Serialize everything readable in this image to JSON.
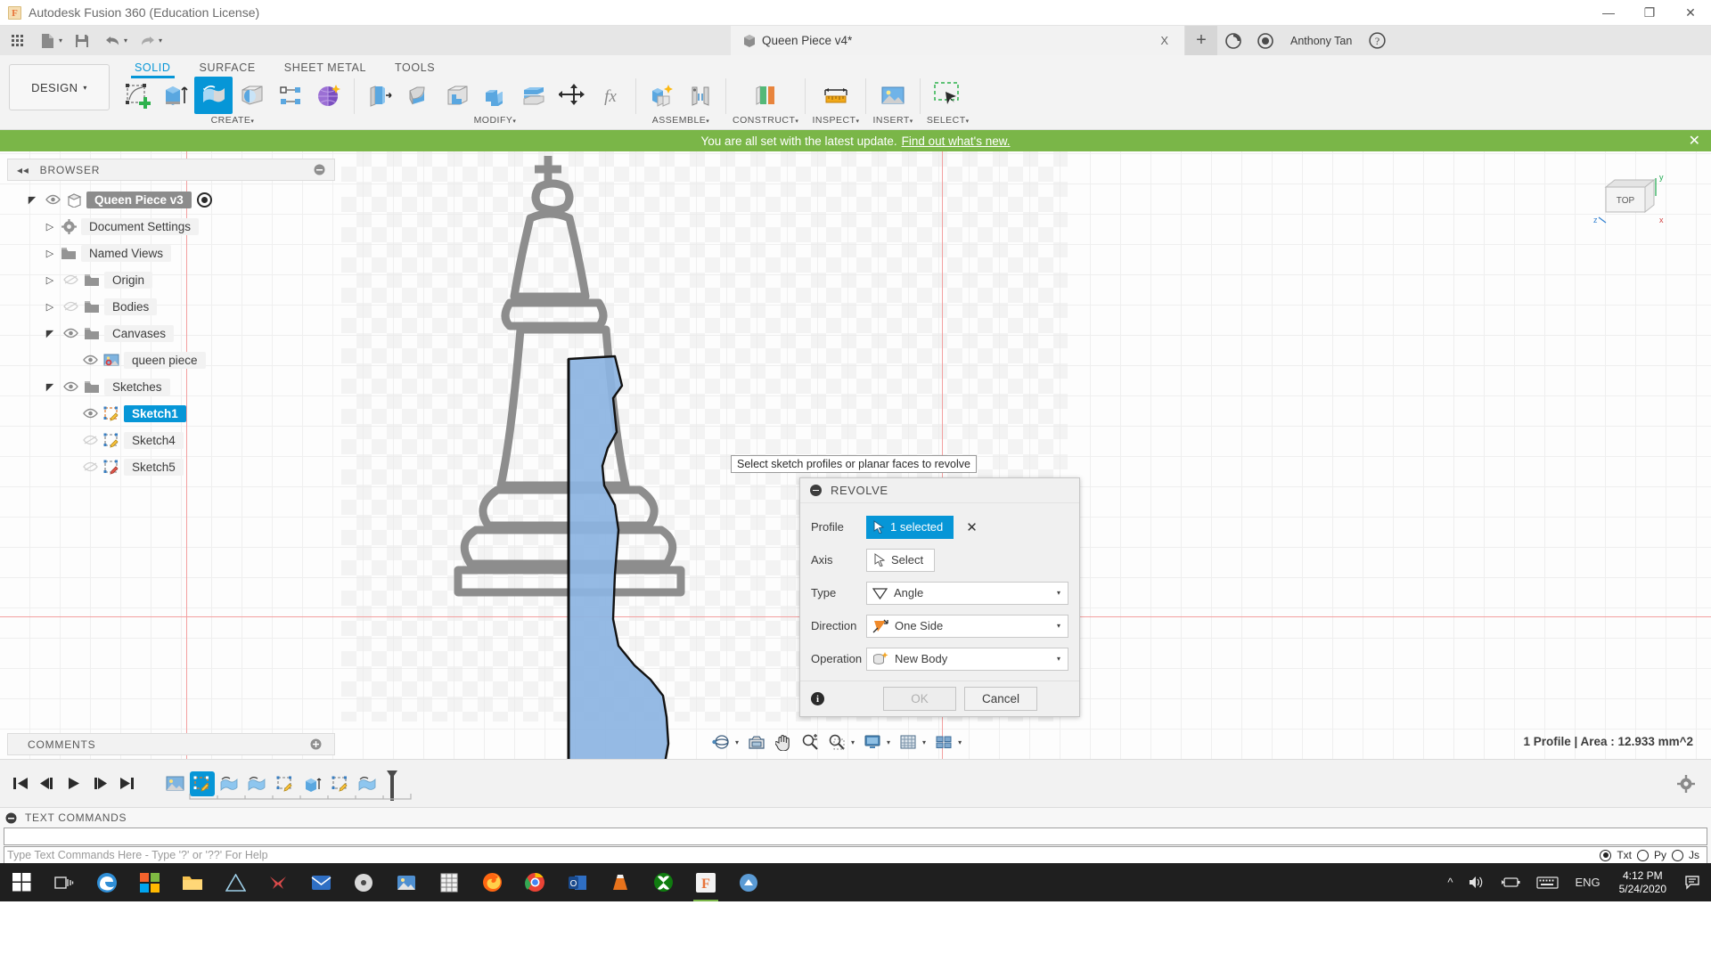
{
  "titlebar": {
    "app_title": "Autodesk Fusion 360 (Education License)",
    "logo_letter": "F",
    "minimize": "—",
    "maximize": "❐",
    "close": "✕"
  },
  "doc_tab": {
    "name": "Queen Piece v4*",
    "close": "X",
    "plus": "+",
    "username": "Anthony Tan"
  },
  "ribbon": {
    "workspace": "DESIGN",
    "workspace_caret": "▾",
    "tabs": [
      {
        "label": "SOLID",
        "active": true
      },
      {
        "label": "SURFACE",
        "active": false
      },
      {
        "label": "SHEET METAL",
        "active": false
      },
      {
        "label": "TOOLS",
        "active": false
      }
    ],
    "groups": [
      {
        "label": "CREATE",
        "caret": "▾"
      },
      {
        "label": "MODIFY",
        "caret": "▾"
      },
      {
        "label": "ASSEMBLE",
        "caret": "▾"
      },
      {
        "label": "CONSTRUCT",
        "caret": "▾"
      },
      {
        "label": "INSPECT",
        "caret": "▾"
      },
      {
        "label": "INSERT",
        "caret": "▾"
      },
      {
        "label": "SELECT",
        "caret": "▾"
      }
    ]
  },
  "banner": {
    "message": "You are all set with the latest update.",
    "link": "Find out what's new.",
    "close": "✕"
  },
  "browser": {
    "title": "BROWSER",
    "collapse": "◂◂",
    "items": [
      {
        "label": "Queen Piece v3",
        "depth": 0,
        "state": "root-selected",
        "arrow": "open",
        "eye": "on",
        "icon": "body-cube-icon",
        "target": true
      },
      {
        "label": "Document Settings",
        "depth": 1,
        "state": "normal",
        "arrow": "closed",
        "eye": "none",
        "icon": "gear-icon"
      },
      {
        "label": "Named Views",
        "depth": 1,
        "state": "normal",
        "arrow": "closed",
        "eye": "none",
        "icon": "folder-icon"
      },
      {
        "label": "Origin",
        "depth": 1,
        "state": "normal",
        "arrow": "closed",
        "eye": "off",
        "icon": "folder-icon"
      },
      {
        "label": "Bodies",
        "depth": 1,
        "state": "normal",
        "arrow": "closed",
        "eye": "off",
        "icon": "folder-icon"
      },
      {
        "label": "Canvases",
        "depth": 1,
        "state": "normal",
        "arrow": "open",
        "eye": "on",
        "icon": "folder-icon"
      },
      {
        "label": "queen piece",
        "depth": 2,
        "state": "normal",
        "arrow": "none",
        "eye": "on",
        "icon": "canvas-image-icon"
      },
      {
        "label": "Sketches",
        "depth": 1,
        "state": "normal",
        "arrow": "open",
        "eye": "on",
        "icon": "folder-icon"
      },
      {
        "label": "Sketch1",
        "depth": 2,
        "state": "selected",
        "arrow": "none",
        "eye": "on",
        "icon": "sketch-icon"
      },
      {
        "label": "Sketch4",
        "depth": 2,
        "state": "normal",
        "arrow": "none",
        "eye": "off",
        "icon": "sketch-icon"
      },
      {
        "label": "Sketch5",
        "depth": 2,
        "state": "normal",
        "arrow": "none",
        "eye": "off",
        "icon": "sketch-icon"
      }
    ]
  },
  "comments": {
    "title": "COMMENTS"
  },
  "tooltip": {
    "text": "Select sketch profiles or planar faces to revolve"
  },
  "revolve_dialog": {
    "title": "REVOLVE",
    "rows": [
      {
        "label": "Profile",
        "value": "1 selected",
        "kind": "selection-active",
        "clear": "✕"
      },
      {
        "label": "Axis",
        "value": "Select",
        "kind": "selection-idle"
      },
      {
        "label": "Type",
        "value": "Angle",
        "kind": "dropdown",
        "icon": "angle-icon"
      },
      {
        "label": "Direction",
        "value": "One Side",
        "kind": "dropdown",
        "icon": "direction-icon"
      },
      {
        "label": "Operation",
        "value": "New Body",
        "kind": "dropdown",
        "icon": "new-body-icon"
      }
    ],
    "ok": "OK",
    "cancel": "Cancel",
    "info": "i"
  },
  "viewcube": {
    "face_label": "TOP",
    "x_axis": "x",
    "y_axis": "y",
    "z_axis": "z"
  },
  "status": {
    "text": "1 Profile | Area : 12.933 mm^2"
  },
  "timeline": {
    "controls": [
      "⏮",
      "◀▎",
      "▶",
      "▎▶",
      "⏭"
    ],
    "features": [
      {
        "name": "canvas-feature",
        "selected": false
      },
      {
        "name": "sketch-feature-1",
        "selected": true
      },
      {
        "name": "revolve-feature-1",
        "selected": false
      },
      {
        "name": "revolve-feature-2",
        "selected": false
      },
      {
        "name": "sketch-feature-2",
        "selected": false
      },
      {
        "name": "extrude-feature",
        "selected": false
      },
      {
        "name": "sketch-feature-3",
        "selected": false
      },
      {
        "name": "revolve-feature-3",
        "selected": false
      }
    ]
  },
  "text_commands": {
    "title": "TEXT COMMANDS",
    "placeholder": "Type Text Commands Here - Type '?' or '??' For Help",
    "value": "",
    "modes": [
      {
        "label": "Txt",
        "selected": true
      },
      {
        "label": "Py",
        "selected": false
      },
      {
        "label": "Js",
        "selected": false
      }
    ]
  },
  "taskbar": {
    "items": [
      {
        "name": "start-button"
      },
      {
        "name": "task-view-button"
      },
      {
        "name": "edge-icon"
      },
      {
        "name": "microsoft-store-icon"
      },
      {
        "name": "file-explorer-icon"
      },
      {
        "name": "autodesk-icon"
      },
      {
        "name": "blender-icon"
      },
      {
        "name": "mail-icon"
      },
      {
        "name": "media-icon"
      },
      {
        "name": "photos-icon"
      },
      {
        "name": "excel-icon"
      },
      {
        "name": "firefox-icon"
      },
      {
        "name": "chrome-icon"
      },
      {
        "name": "outlook-icon"
      },
      {
        "name": "vlc-icon"
      },
      {
        "name": "xbox-icon"
      },
      {
        "name": "fusion360-icon"
      },
      {
        "name": "app-icon"
      }
    ],
    "language": "ENG",
    "time": "4:12 PM",
    "date": "5/24/2020"
  },
  "colors": {
    "accent_blue": "#0696d7",
    "banner_green": "#7ab648",
    "profile_fill": "#8cb4e2",
    "axis_red": "#f3a0a0",
    "chrome_gray": "#f3f3f3"
  }
}
